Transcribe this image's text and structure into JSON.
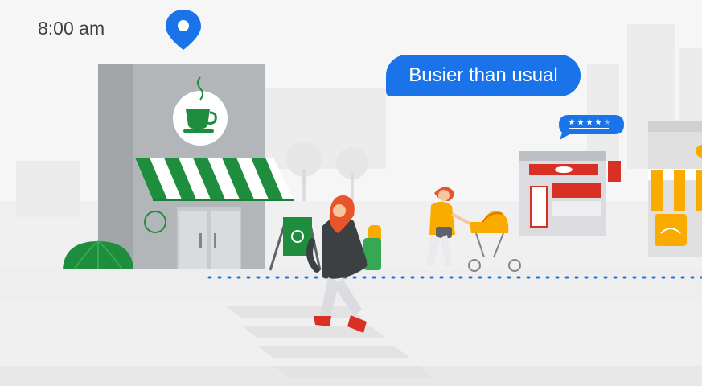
{
  "status": {
    "time": "8:00 am",
    "busyness_message": "Busier than usual"
  },
  "icons": {
    "pin": "location-pin-icon",
    "coffee": "coffee-cup-icon",
    "rating": "star-rating-icon"
  },
  "colors": {
    "accent_blue": "#1a73e8",
    "cafe_green": "#1e8e3e",
    "bakery_red": "#d93025",
    "shop_yellow": "#f9ab00",
    "text_dark": "#3c4043"
  },
  "rating": {
    "stars": 4,
    "max": 5
  }
}
